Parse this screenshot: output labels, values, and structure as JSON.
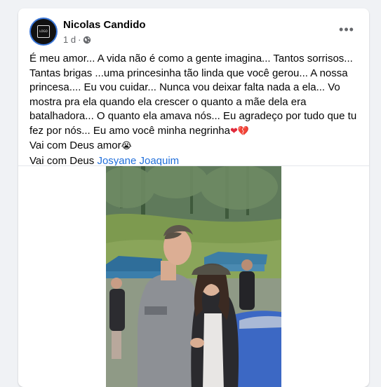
{
  "post": {
    "author": "Nicolas Candido",
    "time": "1 d",
    "separator": "·",
    "more_label": "•••",
    "avatar_text": "LOGO",
    "paragraph_1": "É meu amor... A vida não é como a gente imagina... Tantos sorrisos... Tantas brigas ...uma princesinha tão linda que você gerou... A nossa princesa.... Eu vou cuidar... Nunca vou deixar falta nada a ela... Vo mostra pra ela quando ela crescer o quanto a mãe dela era batalhadora... O quanto ela amava nós... Eu agradeço por tudo que tu fez por nós... Eu amo você minha negrinha",
    "paragraph_1_emoji": "❤💔",
    "line_2": "Vai com Deus amor",
    "line_2_emoji": "😭",
    "line_3_prefix": "Vai com Deus ",
    "tagged_name": "Josyane Joaquim"
  },
  "icons": {
    "audience": "globe-icon",
    "menu": "more-options-icon"
  },
  "colors": {
    "background": "#f0f2f5",
    "card": "#ffffff",
    "link": "#216fdb",
    "muted": "#65676b",
    "heart": "#e02a3c"
  }
}
